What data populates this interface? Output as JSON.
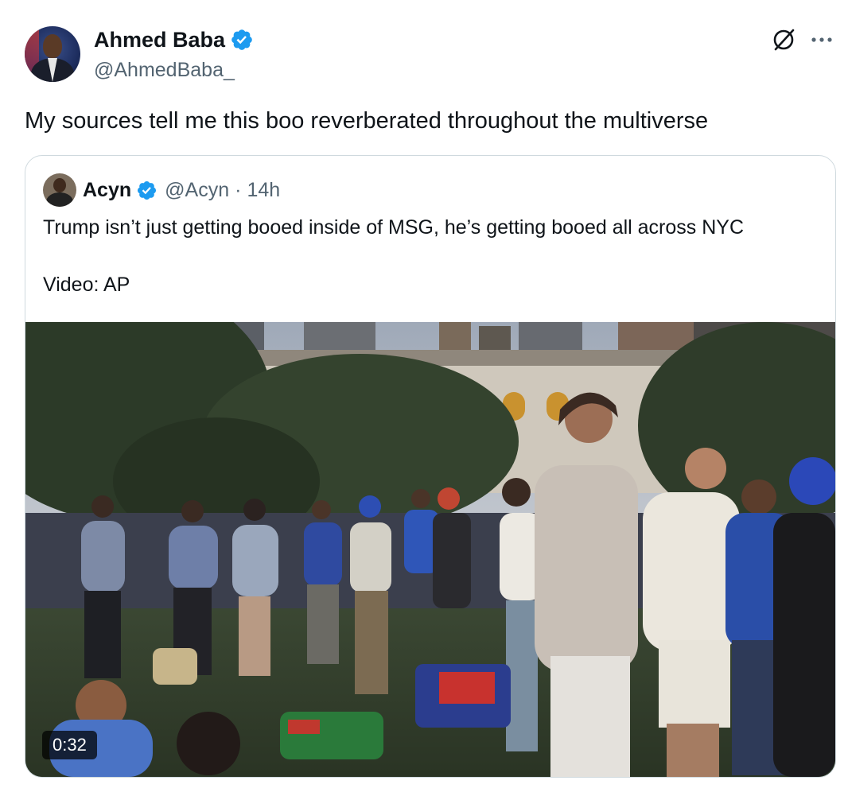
{
  "author": {
    "display_name": "Ahmed Baba",
    "handle": "@AhmedBaba_",
    "verified": true
  },
  "tweet": {
    "text": "My sources tell me this boo reverberated throughout the multiverse"
  },
  "quoted_tweet": {
    "display_name": "Acyn",
    "handle": "@Acyn",
    "separator": "·",
    "time": "14h",
    "verified": true,
    "text_line1": "Trump isn’t just getting booed inside of MSG, he’s getting booed all across NYC",
    "text_line2": "Video: AP",
    "video": {
      "duration": "0:32"
    }
  },
  "icons": {
    "verified": "verified-badge-icon",
    "grok": "grok-icon",
    "more": "more-options-icon"
  },
  "colors": {
    "verified_blue": "#1d9bf0",
    "text_primary": "#0f1419",
    "text_secondary": "#536471",
    "border": "#cfd9de"
  }
}
